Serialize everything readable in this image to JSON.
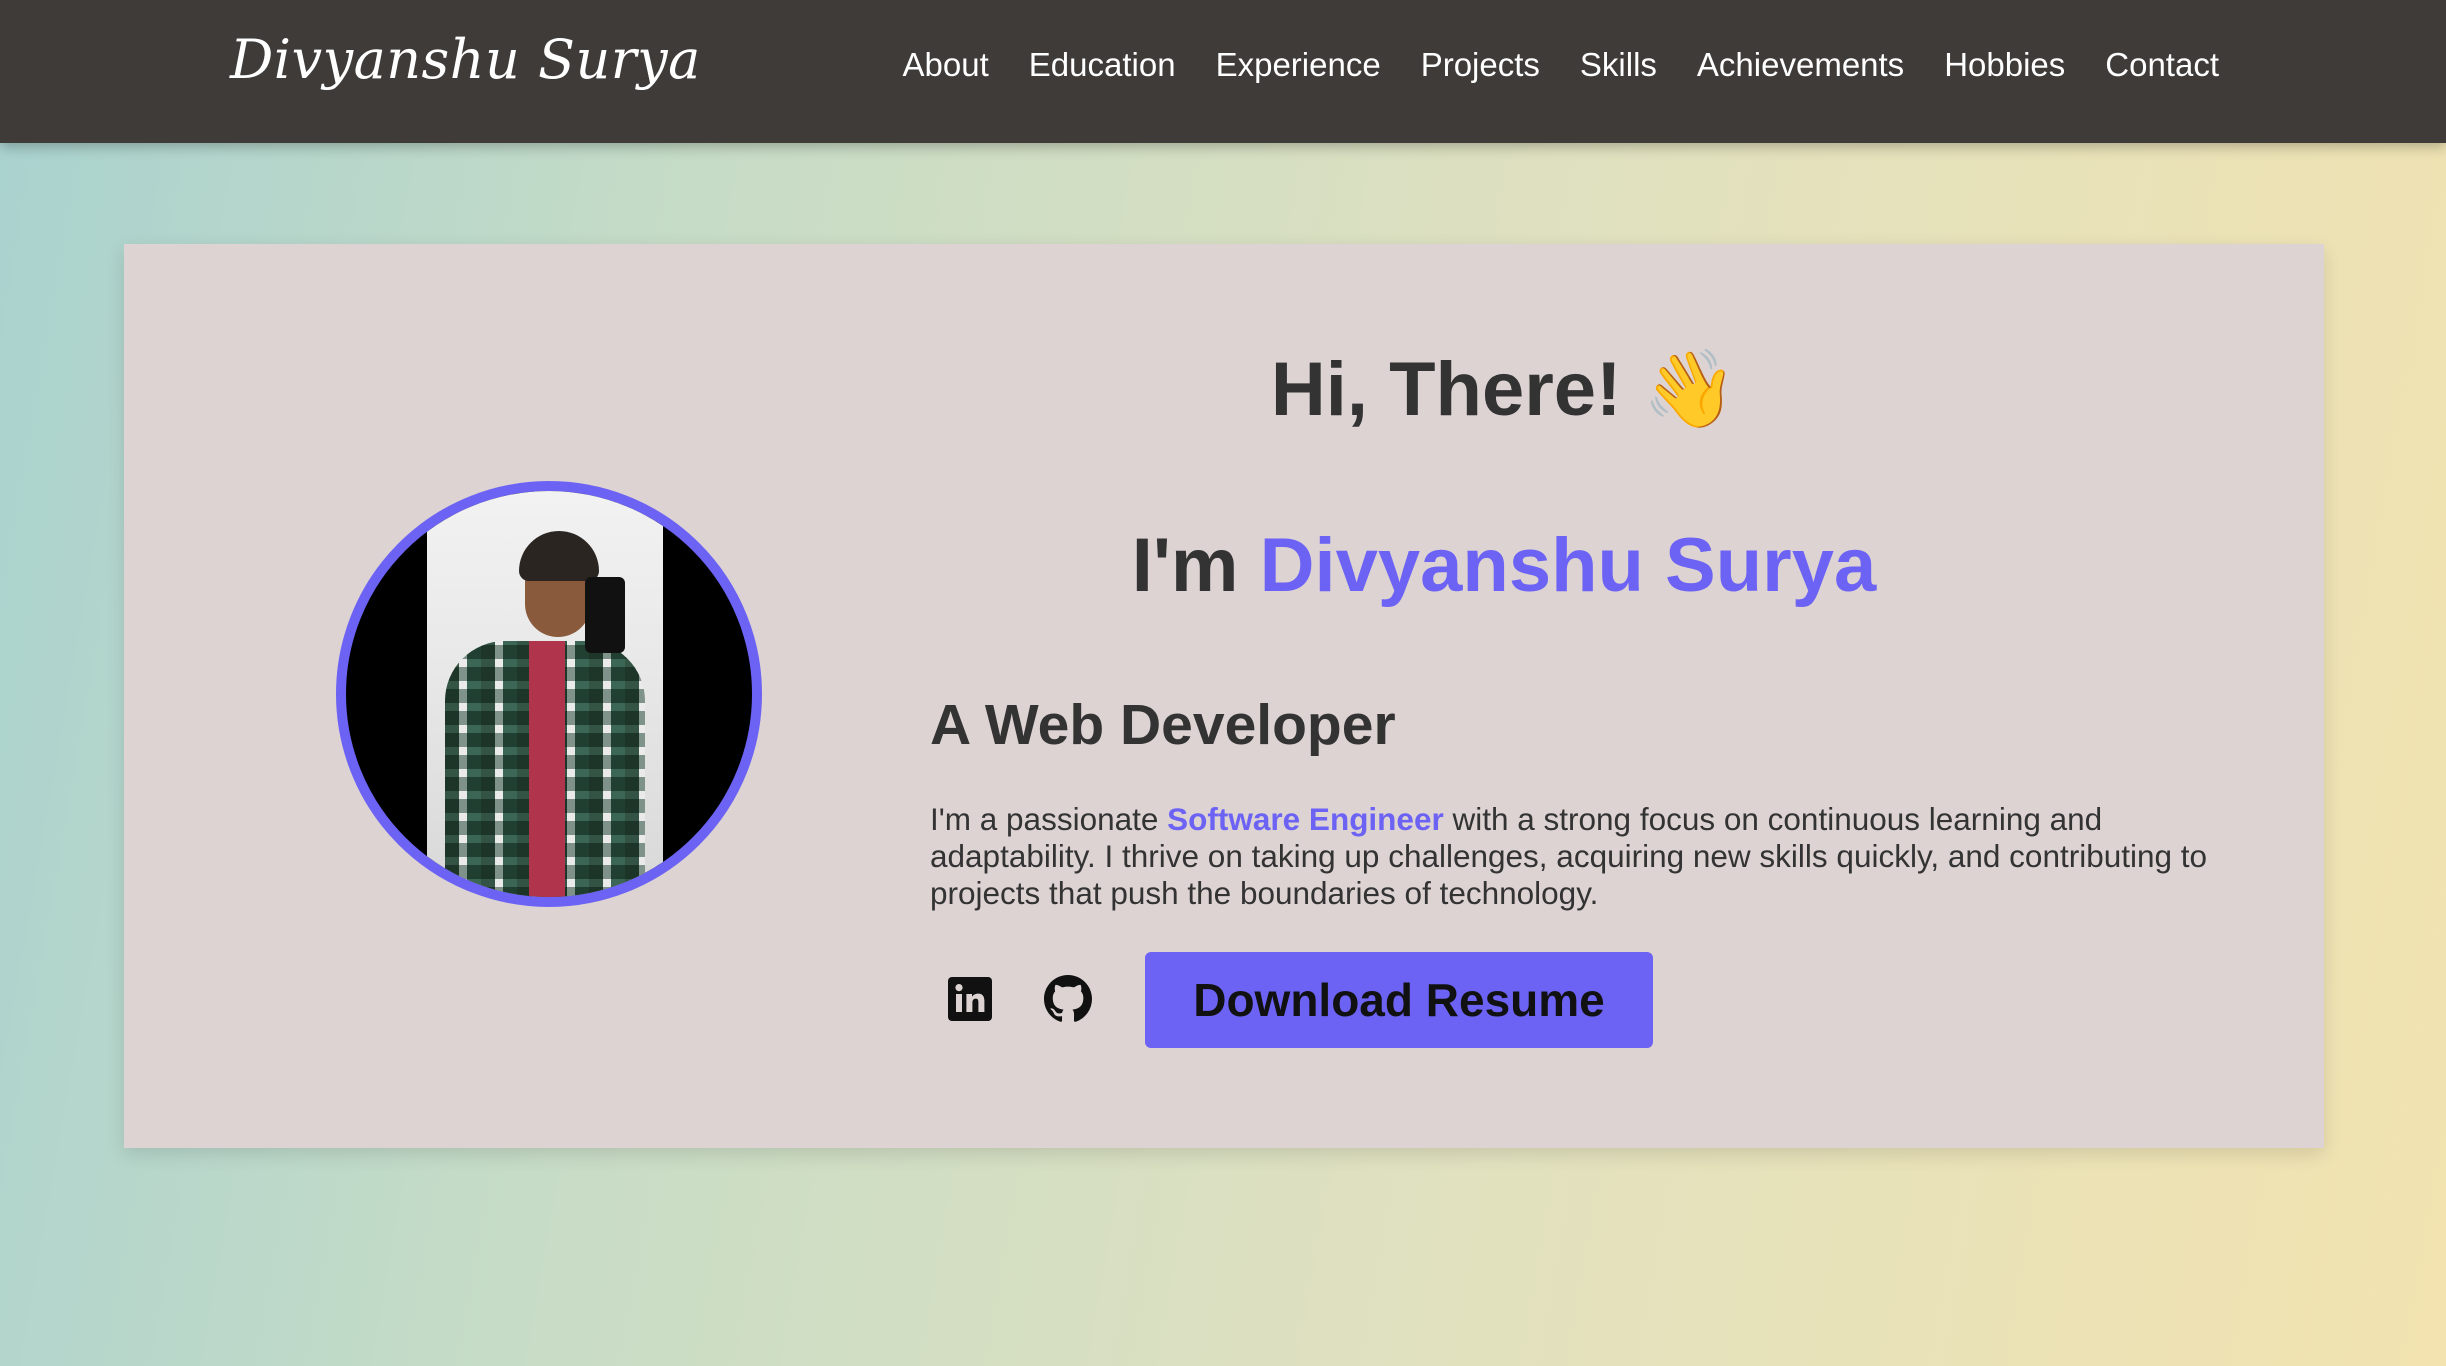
{
  "header": {
    "brand": "Divyanshu Surya",
    "nav": [
      "About",
      "Education",
      "Experience",
      "Projects",
      "Skills",
      "Achievements",
      "Hobbies",
      "Contact"
    ]
  },
  "hero": {
    "greeting": "Hi, There! 👋",
    "intro_prefix": "I'm ",
    "name": "Divyanshu Surya",
    "role": "A Web Developer",
    "desc_before": "I'm a passionate ",
    "desc_highlight": "Software Engineer",
    "desc_after": " with a strong focus on continuous learning and adaptability. I thrive on taking up challenges, acquiring new skills quickly, and contributing to projects that push the boundaries of technology.",
    "resume_label": "Download Resume",
    "social_icons": [
      "linkedin-icon",
      "github-icon"
    ]
  },
  "colors": {
    "accent": "#6c63f5",
    "navbar": "#3e3b39",
    "card": "#ddd3d3",
    "text": "#333333"
  }
}
